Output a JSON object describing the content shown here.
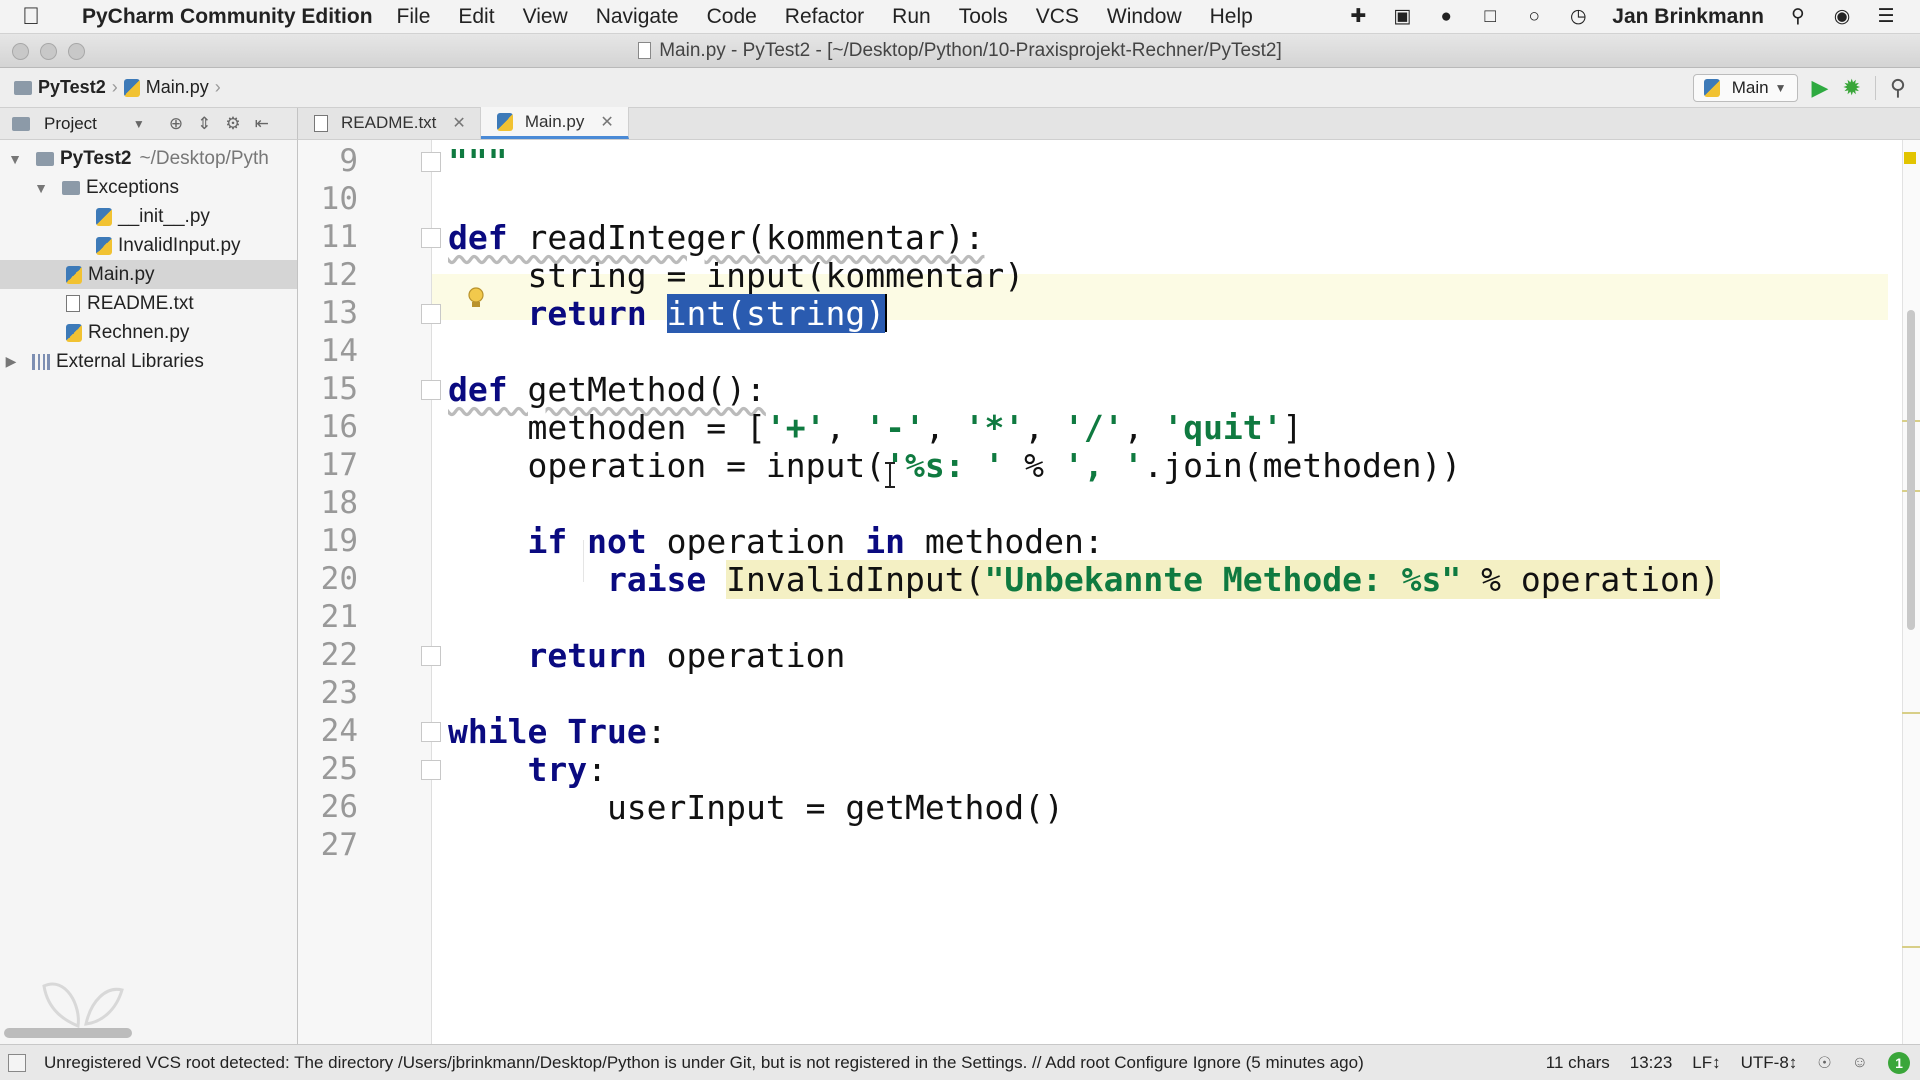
{
  "menubar": {
    "app_name": "PyCharm Community Edition",
    "items": [
      "File",
      "Edit",
      "View",
      "Navigate",
      "Code",
      "Refactor",
      "Run",
      "Tools",
      "VCS",
      "Window",
      "Help"
    ],
    "user": "Jan Brinkmann",
    "tray_icons": [
      "plugin-icon",
      "display-icon",
      "drop-icon",
      "camera-icon",
      "chat-icon",
      "clock-icon"
    ]
  },
  "window": {
    "title": "Main.py - PyTest2 - [~/Desktop/Python/10-Praxisprojekt-Rechner/PyTest2]"
  },
  "navbar": {
    "crumbs": [
      "PyTest2",
      "Main.py"
    ],
    "run_config": "Main"
  },
  "project_panel": {
    "label": "Project"
  },
  "tabs": [
    {
      "label": "README.txt",
      "active": false
    },
    {
      "label": "Main.py",
      "active": true
    }
  ],
  "tree": {
    "root": {
      "name": "PyTest2",
      "path": "~/Desktop/Pyth"
    },
    "folder": "Exceptions",
    "folder_files": [
      "__init__.py",
      "InvalidInput.py"
    ],
    "files": [
      "Main.py",
      "README.txt",
      "Rechnen.py"
    ],
    "libraries": "External Libraries"
  },
  "editor": {
    "line_numbers": [
      "9",
      "10",
      "11",
      "12",
      "13",
      "14",
      "15",
      "16",
      "17",
      "18",
      "19",
      "20",
      "21",
      "22",
      "23",
      "24",
      "25",
      "26",
      "27"
    ],
    "tokens": {
      "l9": "\"\"\"",
      "def": "def",
      "l11_rest": " readInteger(kommentar):",
      "l12": "    string = input(kommentar)",
      "return": "return",
      "l13_sel": "int(string)",
      "l15_rest": " getMethod():",
      "l16_a": "    methoden = [",
      "l16_plus": "'+'",
      "l16_minus": "'-'",
      "l16_times": "'*'",
      "l16_div": "'/'",
      "l16_quit": "'quit'",
      "l16_close": "]",
      "comma": ", ",
      "l17_a": "    operation = input(",
      "l17_fmt": "'%s: '",
      "l17_b": " % ",
      "l17_sep": "', '",
      "l17_c": ".join(methoden))",
      "if": "if",
      "not": "not",
      "l19_mid": " operation ",
      "in": "in",
      "l19_end": " methoden:",
      "raise": "raise",
      "l20_a": "InvalidInput(",
      "l20_str": "\"Unbekannte Methode: %s\"",
      "l20_b": " % operation)",
      "l22_rest": " operation",
      "while": "while",
      "true_kw": "True",
      "colon": ":",
      "try": "try",
      "l26": "        userInput = getMethod()"
    }
  },
  "statusbar": {
    "message": "Unregistered VCS root detected: The directory /Users/jbrinkmann/Desktop/Python is under Git, but is not registered in the Settings. // Add root  Configure  Ignore (5 minutes ago)",
    "chars": "11 chars",
    "position": "13:23",
    "line_sep": "LF↕",
    "encoding": "UTF-8↕",
    "event_count": "1"
  }
}
